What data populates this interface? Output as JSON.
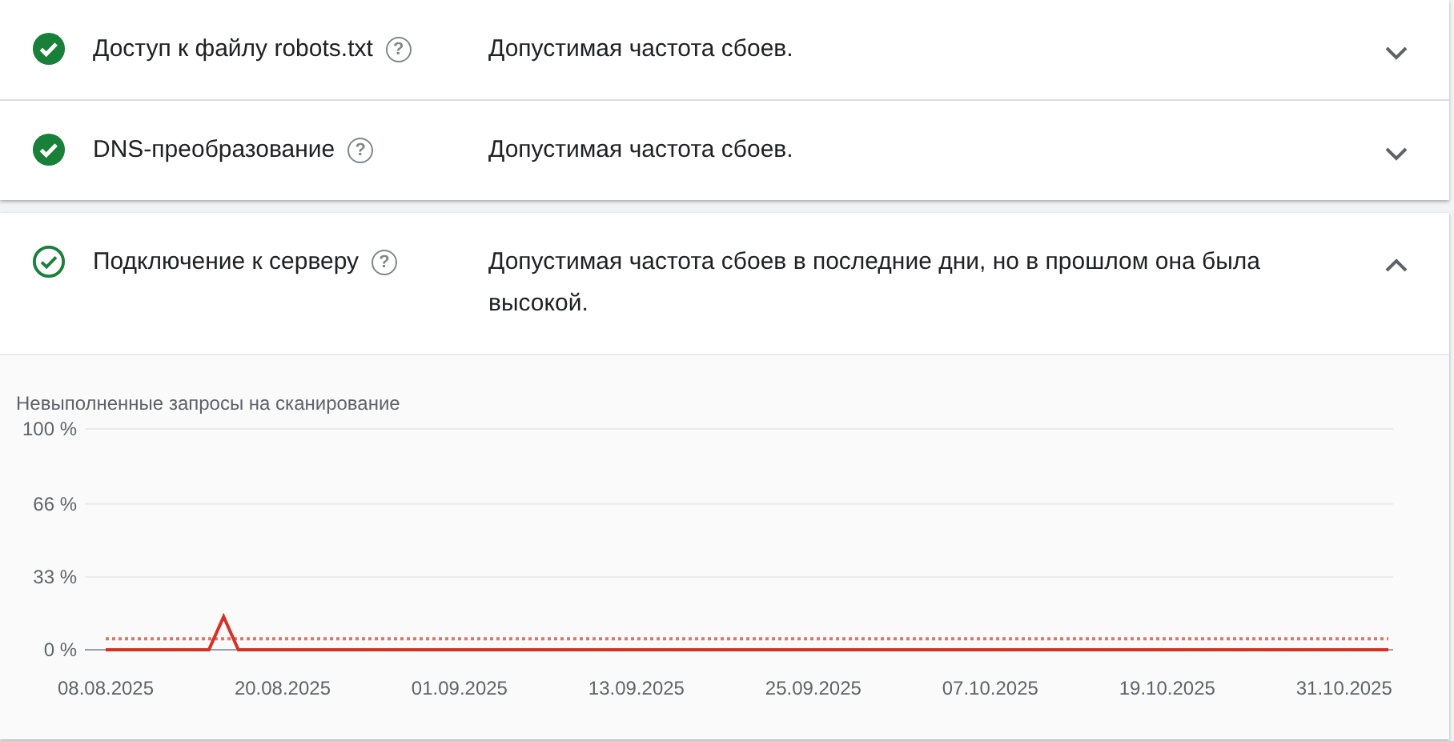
{
  "groups": [
    {
      "rows": [
        {
          "kind": "check_filled",
          "title": "Доступ к файлу robots.txt",
          "help": "?",
          "status": "Допустимая частота сбоев.",
          "expanded": false
        },
        {
          "kind": "check_filled",
          "title": "DNS-преобразование",
          "help": "?",
          "status": "Допустимая частота сбоев.",
          "expanded": false
        }
      ]
    },
    {
      "rows": [
        {
          "kind": "check_outline",
          "title": "Подключение к серверу",
          "help": "?",
          "status": "Допустимая частота сбоев в последние дни, но в прошлом она была высокой.",
          "expanded": true,
          "chart_data": {
            "type": "line",
            "title": "Невыполненные запросы на сканирование",
            "categories": [
              "08.08.2025",
              null,
              null,
              null,
              null,
              null,
              null,
              null,
              null,
              null,
              null,
              null,
              "20.08.2025",
              null,
              null,
              null,
              null,
              null,
              null,
              null,
              null,
              null,
              null,
              null,
              "01.09.2025",
              null,
              null,
              null,
              null,
              null,
              null,
              null,
              null,
              null,
              null,
              null,
              "13.09.2025",
              null,
              null,
              null,
              null,
              null,
              null,
              null,
              null,
              null,
              null,
              null,
              "25.09.2025",
              null,
              null,
              null,
              null,
              null,
              null,
              null,
              null,
              null,
              null,
              null,
              "07.10.2025",
              null,
              null,
              null,
              null,
              null,
              null,
              null,
              null,
              null,
              null,
              null,
              "19.10.2025",
              null,
              null,
              null,
              null,
              null,
              null,
              null,
              null,
              null,
              null,
              null,
              "31.10.2025",
              null,
              null,
              null
            ],
            "series": [
              {
                "color": "#d93025",
                "values": [
                  0,
                  0,
                  0,
                  0,
                  0,
                  0,
                  0,
                  0,
                  15,
                  0,
                  0,
                  0,
                  0,
                  0,
                  0,
                  0,
                  0,
                  0,
                  0,
                  0,
                  0,
                  0,
                  0,
                  0,
                  0,
                  0,
                  0,
                  0,
                  0,
                  0,
                  0,
                  0,
                  0,
                  0,
                  0,
                  0,
                  0,
                  0,
                  0,
                  0,
                  0,
                  0,
                  0,
                  0,
                  0,
                  0,
                  0,
                  0,
                  0,
                  0,
                  0,
                  0,
                  0,
                  0,
                  0,
                  0,
                  0,
                  0,
                  0,
                  0,
                  0,
                  0,
                  0,
                  0,
                  0,
                  0,
                  0,
                  0,
                  0,
                  0,
                  0,
                  0,
                  0,
                  0,
                  0,
                  0,
                  0,
                  0,
                  0,
                  0,
                  0,
                  0,
                  0,
                  0,
                  0,
                  0,
                  0,
                  0
                ]
              },
              {
                "color": "#e57368",
                "line_style": "dotted",
                "values": [
                  5,
                  5,
                  5,
                  5,
                  5,
                  5,
                  5,
                  5,
                  5,
                  5,
                  5,
                  5,
                  5,
                  5,
                  5,
                  5,
                  5,
                  5,
                  5,
                  5,
                  5,
                  5,
                  5,
                  5,
                  5,
                  5,
                  5,
                  5,
                  5,
                  5,
                  5,
                  5,
                  5,
                  5,
                  5,
                  5,
                  5,
                  5,
                  5,
                  5,
                  5,
                  5,
                  5,
                  5,
                  5,
                  5,
                  5,
                  5,
                  5,
                  5,
                  5,
                  5,
                  5,
                  5,
                  5,
                  5,
                  5,
                  5,
                  5,
                  5,
                  5,
                  5,
                  5,
                  5,
                  5,
                  5,
                  5,
                  5,
                  5,
                  5,
                  5,
                  5,
                  5,
                  5,
                  5,
                  5,
                  5,
                  5,
                  5,
                  5,
                  5,
                  5,
                  5,
                  5,
                  5,
                  5,
                  5,
                  5
                ]
              }
            ],
            "yticks": [
              {
                "value": 0,
                "label": "0 %"
              },
              {
                "value": 33,
                "label": "33 %"
              },
              {
                "value": 66,
                "label": "66 %"
              },
              {
                "value": 100,
                "label": "100 %"
              }
            ],
            "ylim": [
              0,
              100
            ]
          }
        }
      ]
    }
  ]
}
